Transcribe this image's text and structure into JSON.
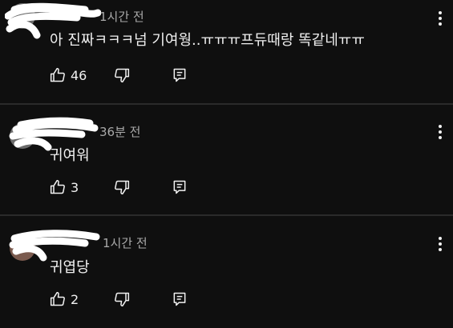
{
  "comments": [
    {
      "time": "1시간 전",
      "text": "아 진짜ㅋㅋㅋ넘 기여웡..ㅠㅠㅠ프듀때랑 똑같네ㅠㅠ",
      "likes": "46"
    },
    {
      "time": "36분 전",
      "text": "귀여워",
      "likes": "3"
    },
    {
      "time": "1시간 전",
      "text": "귀엽당",
      "likes": "2"
    }
  ],
  "icons": {
    "like": "thumbs-up-icon",
    "dislike": "thumbs-down-icon",
    "reply": "reply-icon",
    "more": "more-vertical-icon"
  },
  "colors": {
    "background": "#0f0f0f",
    "text": "#f1f1f1",
    "meta": "#aaaaaa"
  }
}
